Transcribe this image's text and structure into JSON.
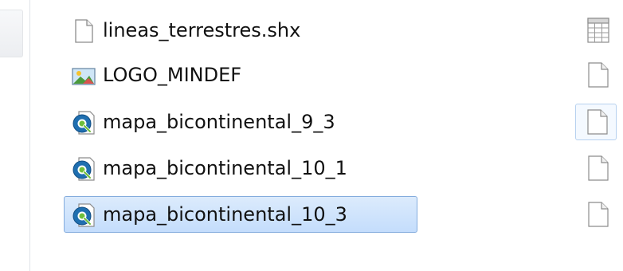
{
  "files": [
    {
      "name": "lineas_terrestres.shx",
      "icon": "blank-document-icon",
      "selected": false
    },
    {
      "name": "LOGO_MINDEF",
      "icon": "image-file-icon",
      "selected": false
    },
    {
      "name": "mapa_bicontinental_9_3",
      "icon": "qgis-project-icon",
      "selected": false
    },
    {
      "name": "mapa_bicontinental_10_1",
      "icon": "qgis-project-icon",
      "selected": false
    },
    {
      "name": "mapa_bicontinental_10_3",
      "icon": "qgis-project-icon",
      "selected": true
    }
  ],
  "right_column": [
    {
      "icon": "grid-table-icon"
    },
    {
      "icon": "blank-document-icon"
    },
    {
      "icon": "blank-document-icon",
      "hover": true
    },
    {
      "icon": "blank-document-icon"
    },
    {
      "icon": "blank-document-icon"
    }
  ],
  "colors": {
    "selection_fill": "#c4ddfc",
    "selection_border": "#84acdd",
    "qgis_blue": "#1f6fb0",
    "qgis_green": "#6fbf3a"
  }
}
